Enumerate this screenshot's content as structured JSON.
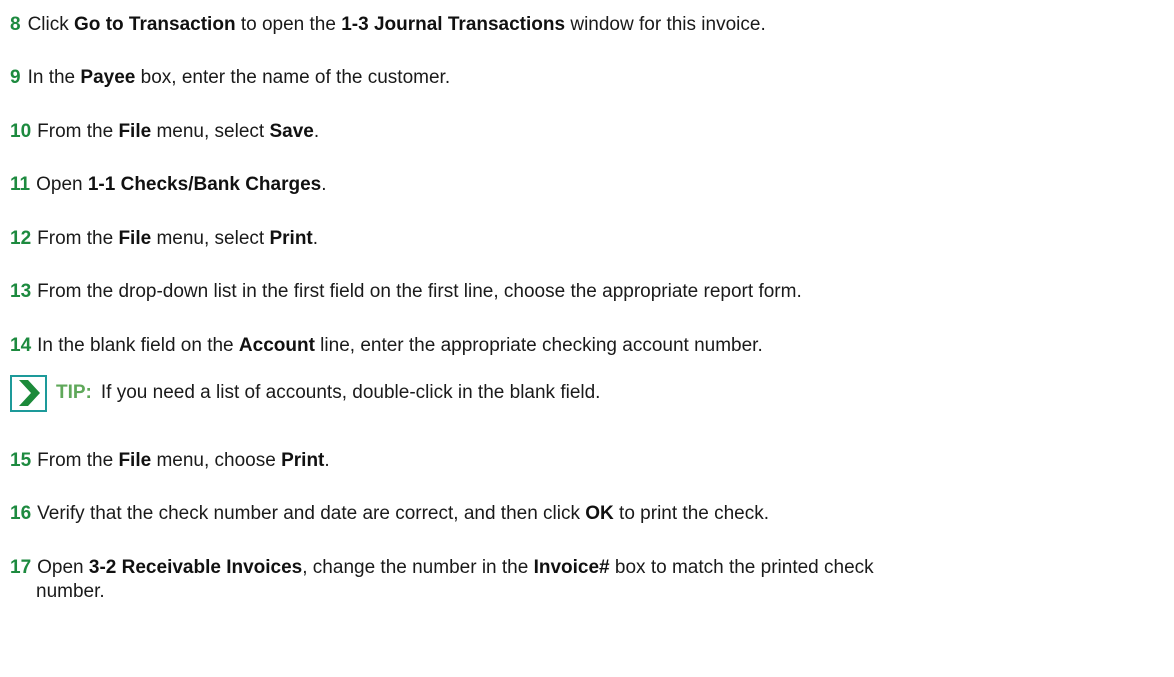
{
  "steps": [
    {
      "num": "8",
      "parts": [
        "Click ",
        "Go to Transaction",
        " to open the ",
        "1-3 Journal Transactions",
        " window for this invoice."
      ]
    },
    {
      "num": "9",
      "parts": [
        "In the ",
        "Payee",
        " box, enter the name of the customer."
      ]
    },
    {
      "num": "10",
      "parts": [
        "From the ",
        "File",
        " menu, select ",
        "Save",
        "."
      ]
    },
    {
      "num": "11",
      "parts": [
        "Open ",
        "1-1 Checks/Bank Charges",
        "."
      ]
    },
    {
      "num": "12",
      "parts": [
        "From the ",
        "File",
        " menu, select ",
        "Print",
        "."
      ]
    },
    {
      "num": "13",
      "parts": [
        "From the drop-down list in the first field on the first line, choose the appropriate report form."
      ]
    },
    {
      "num": "14",
      "parts": [
        "In the blank field on the ",
        "Account",
        " line, enter the appropriate checking account number."
      ]
    },
    {
      "num": "15",
      "parts": [
        "From the ",
        "File",
        " menu, choose ",
        "Print",
        "."
      ]
    },
    {
      "num": "16",
      "parts": [
        "Verify that the check number and date are correct, and then click ",
        "OK",
        " to print the check."
      ]
    },
    {
      "num": "17",
      "parts": [
        "Open ",
        "3-2 Receivable Invoices",
        ", change the number in the ",
        "Invoice#",
        " box to match the printed check"
      ]
    }
  ],
  "step17_continuation": "number.",
  "tip": {
    "icon": "chevron-right-icon",
    "label": "TIP:",
    "text": "If you need a list of accounts, double-click in the blank field."
  },
  "colors": {
    "step_number": "#1d8a3f",
    "tip_label": "#5fa85a",
    "tip_icon_border": "#1d9a9a",
    "tip_icon_fill": "#1c8a3a"
  }
}
